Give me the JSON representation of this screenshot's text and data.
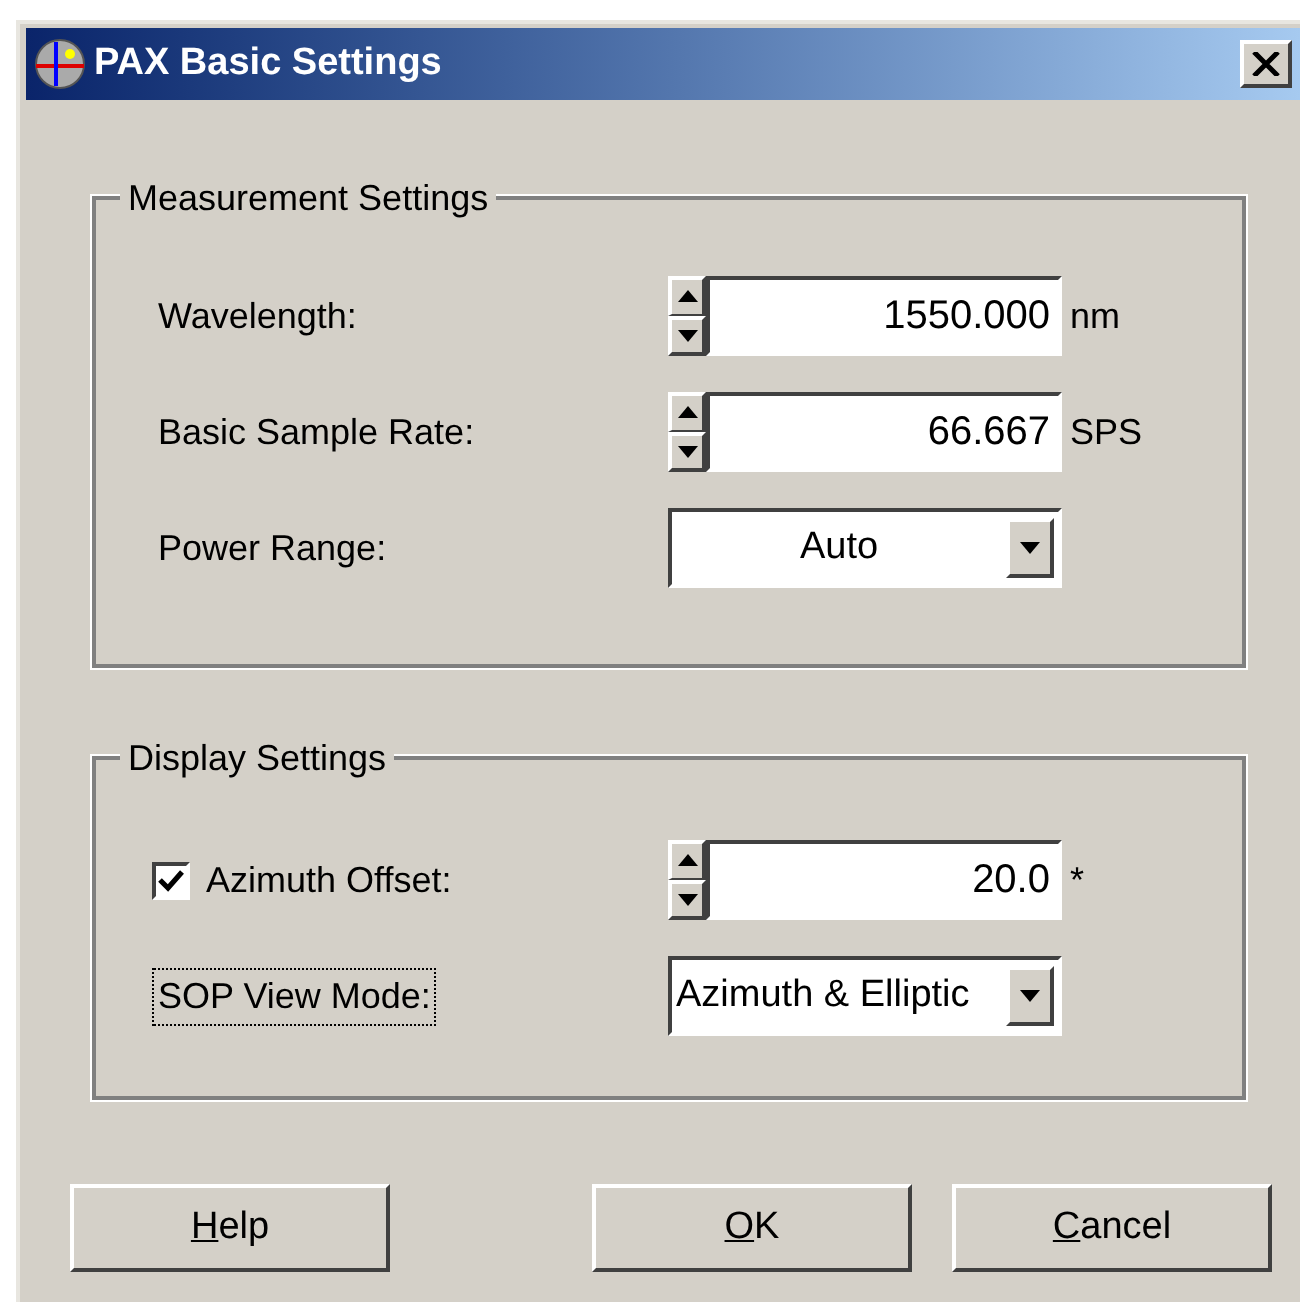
{
  "window": {
    "title": "PAX Basic Settings"
  },
  "groups": [
    {
      "title": "Measurement Settings",
      "rows": [
        {
          "kind": "spin",
          "label": "Wavelength:",
          "value": "1550.000",
          "unit": "nm"
        },
        {
          "kind": "spin",
          "label": "Basic Sample Rate:",
          "value": "66.667",
          "unit": "SPS"
        },
        {
          "kind": "combo",
          "label": "Power Range:",
          "value": "Auto"
        }
      ]
    },
    {
      "title": "Display Settings",
      "rows": [
        {
          "kind": "checkspin",
          "label": "Azimuth Offset:",
          "checked": true,
          "value": "20.0",
          "unit": "*"
        },
        {
          "kind": "list",
          "label": "SOP View Mode:",
          "value": "Azimuth & Elliptic",
          "focused": true
        }
      ]
    }
  ],
  "buttons": [
    {
      "label": "Help"
    },
    {
      "label": "OK"
    },
    {
      "label": "Cancel"
    }
  ]
}
